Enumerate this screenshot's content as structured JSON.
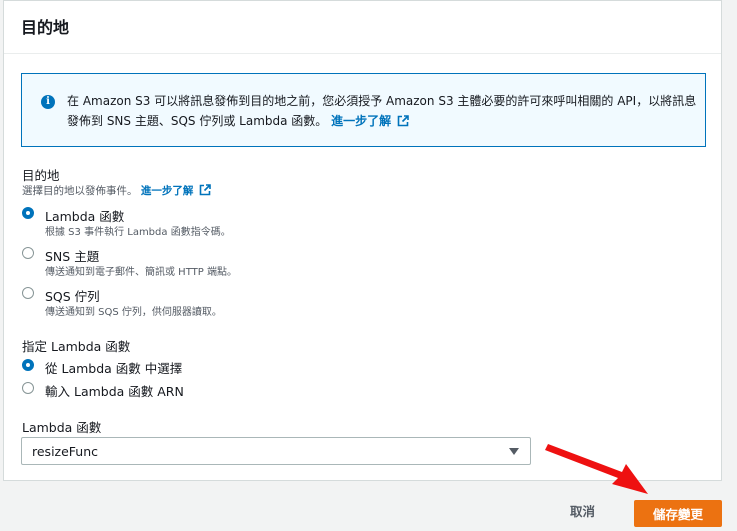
{
  "panel": {
    "title": "目的地"
  },
  "alert": {
    "icon": "info-icon",
    "text": "在 Amazon S3 可以將訊息發佈到目的地之前，您必須授予 Amazon S3 主體必要的許可來呼叫相關的 API，以將訊息發佈到 SNS 主題、SQS 佇列或 Lambda 函數。",
    "link": "進一步了解"
  },
  "destination": {
    "label": "目的地",
    "desc": "選擇目的地以發佈事件。",
    "link": "進一步了解",
    "options": [
      {
        "label": "Lambda 函數",
        "desc": "根據 S3 事件執行 Lambda 函數指令碼。",
        "checked": true
      },
      {
        "label": "SNS 主題",
        "desc": "傳送通知到電子郵件、簡訊或 HTTP 端點。",
        "checked": false
      },
      {
        "label": "SQS 佇列",
        "desc": "傳送通知到 SQS 佇列，供伺服器讀取。",
        "checked": false
      }
    ]
  },
  "lambda_spec": {
    "label": "指定 Lambda 函數",
    "options": [
      {
        "label": "從 Lambda 函數 中選擇",
        "checked": true
      },
      {
        "label": "輸入 Lambda 函數 ARN",
        "checked": false
      }
    ]
  },
  "lambda_select": {
    "label": "Lambda 函數",
    "value": "resizeFunc"
  },
  "footer": {
    "cancel": "取消",
    "save": "儲存變更"
  },
  "colors": {
    "accent": "#0073bb",
    "primary_button": "#ec7211",
    "annotation_arrow": "#ee1111"
  }
}
